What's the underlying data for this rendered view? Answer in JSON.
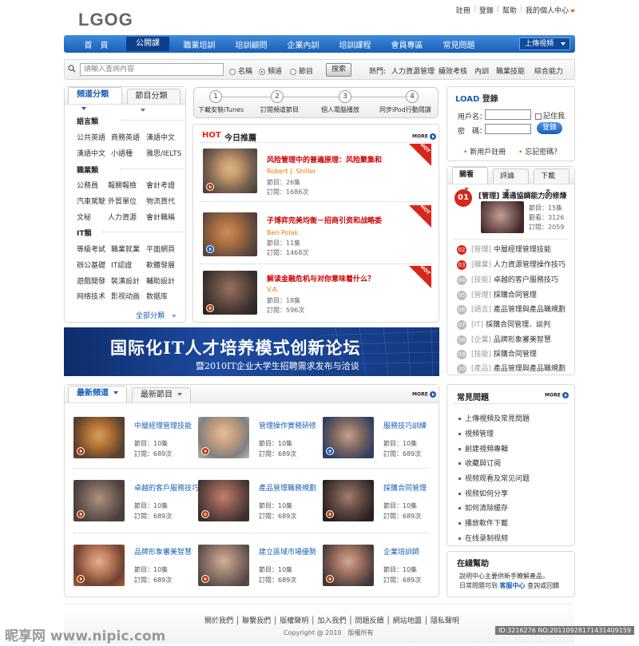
{
  "header": {
    "logo": "LGOG",
    "links": [
      "註冊",
      "登錄",
      "幫助",
      "我的個人中心"
    ]
  },
  "nav": {
    "items": [
      "首　頁",
      "公開課",
      "職業培訓",
      "培訓顧問",
      "企業內訓",
      "培訓課程",
      "會員專區",
      "常見問題"
    ],
    "active": 1,
    "upload": "上傳視頻"
  },
  "search": {
    "placeholder": "請輸入查詢內容",
    "opts": [
      "名稱",
      "頻道",
      "節目"
    ],
    "selected": 1,
    "button": "搜索",
    "hot_label": "熱門:",
    "hot": [
      "人力資源管理",
      "績效考核",
      "內訓",
      "職業技能",
      "綜合能力"
    ]
  },
  "cats": {
    "tabs": [
      "頻道分類",
      "節目分類"
    ],
    "sections": [
      {
        "name": "語言類",
        "rows": [
          [
            "公共英語",
            "商務英語",
            "漢語中文"
          ],
          [
            "漢語中文",
            "小語種",
            "雅思/IELTS"
          ]
        ]
      },
      {
        "name": "職業類",
        "rows": [
          [
            "公務員",
            "報關報檢",
            "會計考證"
          ],
          [
            "汽車駕駛",
            "外貿單位",
            "物流貨代"
          ],
          [
            "文秘",
            "人力資源",
            "會計職稱"
          ]
        ]
      },
      {
        "name": "IT類",
        "rows": [
          [
            "等級考試",
            "職業就業",
            "平面網頁"
          ],
          [
            "辦公基礎",
            "IT認證",
            "軟體發展"
          ],
          [
            "遊戲開發",
            "裝潢設計",
            "輔助設計"
          ],
          [
            "网络技术",
            "影视动画",
            "数据库"
          ]
        ]
      }
    ],
    "all": "全部分類　»"
  },
  "steps": [
    {
      "n": "1",
      "label": "下載安裝iTunes"
    },
    {
      "n": "2",
      "label": "訂閱頻道節目"
    },
    {
      "n": "3",
      "label": "個人電腦播放"
    },
    {
      "n": "4",
      "label": "同步iPod行動閱讀"
    }
  ],
  "recommend": {
    "hot": "HOT",
    "title": "今日推薦",
    "more": "MORE",
    "items": [
      {
        "title": "风险管理中的普遍原理：风险聚集和",
        "author": "Robert J. Shiller",
        "episodes": "節目：26集",
        "subs": "訂閱：1686次"
      },
      {
        "title": "子博弈完美均衡－招商引资和战略委",
        "author": "Ben Polak",
        "episodes": "節目：11集",
        "subs": "訂閱：1468次"
      },
      {
        "title": "解读金融危机与对你意味着什么？",
        "author": "V.A.",
        "episodes": "節目：18集",
        "subs": "訂閱：596次"
      }
    ],
    "badge": "HOT"
  },
  "banner": {
    "line1": "国际化IT人才培养模式创新论坛",
    "line2": "暨2010IT企业大学生招聘需求发布与洽谈"
  },
  "newest": {
    "tabs": [
      "最新頻道",
      "最新節目"
    ],
    "more": "MORE",
    "items": [
      {
        "title": "中層經理管理技能",
        "episodes": "節目：10集",
        "subs": "訂閱：689次"
      },
      {
        "title": "管理操作實務研修",
        "episodes": "節目：10集",
        "subs": "訂閱：689次"
      },
      {
        "title": "服務技巧訓練",
        "episodes": "節目：10集",
        "subs": "訂閱：689次"
      },
      {
        "title": "卓越的客戶服務技巧",
        "episodes": "節目：10集",
        "subs": "訂閱：689次"
      },
      {
        "title": "產品管理職務規劃",
        "episodes": "節目：10集",
        "subs": "訂閱：689次"
      },
      {
        "title": "採購合同管理",
        "episodes": "節目：10集",
        "subs": "訂閱：689次"
      },
      {
        "title": "品牌形象審美智慧",
        "episodes": "節目：10集",
        "subs": "訂閱：689次"
      },
      {
        "title": "建立區域市場優勢",
        "episodes": "節目：10集",
        "subs": "訂閱：689次"
      },
      {
        "title": "企業培訓師",
        "episodes": "節目：10集",
        "subs": "訂閱：689次"
      }
    ]
  },
  "login": {
    "brand": "LOAD",
    "title": "登錄",
    "user": "用戶名：",
    "pass": "密　碼：",
    "remember": "記住我",
    "button": "登錄",
    "register": "新用戶註冊",
    "forgot": "忘記密碼？"
  },
  "ranking": {
    "tabs": [
      "關看",
      "評論",
      "下載"
    ],
    "top": {
      "n": "01",
      "title": "[管理] 溝通協調能力的修煉",
      "episodes": "節目：15集",
      "views": "觀看：3126",
      "subs": "訂閱：2059"
    },
    "items": [
      {
        "n": "02",
        "tag": "[管理]",
        "title": "中層經理管理技能"
      },
      {
        "n": "03",
        "tag": "[職業]",
        "title": "人力資源管理操作技巧"
      },
      {
        "n": "04",
        "tag": "[技能]",
        "title": "卓越的客户服務技巧"
      },
      {
        "n": "05",
        "tag": "[管理]",
        "title": "採購合同管理"
      },
      {
        "n": "06",
        "tag": "[語言]",
        "title": "產品管理與產品職規劃"
      },
      {
        "n": "07",
        "tag": "[IT]",
        "title": "採購合同管理、談判"
      },
      {
        "n": "08",
        "tag": "[企業]",
        "title": "品牌形象審美智慧"
      },
      {
        "n": "09",
        "tag": "[技能]",
        "title": "採購合同管理"
      },
      {
        "n": "10",
        "tag": "[產品]",
        "title": "產品管理與產品職規劃"
      }
    ]
  },
  "faq": {
    "title": "常見問題",
    "more": "MORE",
    "items": [
      "上傳視頻及常見問題",
      "視頻管理",
      "創建視頻專輯",
      "收藏與订阅",
      "视频观看及常见问题",
      "视频如何分享",
      "如何清除缓存",
      "播放軟件下載",
      "在线录制视频"
    ]
  },
  "help": {
    "title": "在綫幫助",
    "text1": "說明中心主要供新手瞭解產品，",
    "text2": "日常問題可到",
    "link": "客服中心",
    "text3": "查詢或回饋"
  },
  "footer": {
    "links": "關於我們 │ 聯繫我們 │ 版權聲明 │ 加入我們 │ 問題反饋 │ 網站地圖 │ 隱私聲明",
    "copy": "Copyright @ 2010　版權所有"
  },
  "watermark": {
    "brand": "昵享网 www.nipic.com",
    "id": "ID:3216276 NO:20110928171431409159"
  },
  "colors": {
    "brand": "#1a5fb5",
    "hot": "#d7261a"
  }
}
